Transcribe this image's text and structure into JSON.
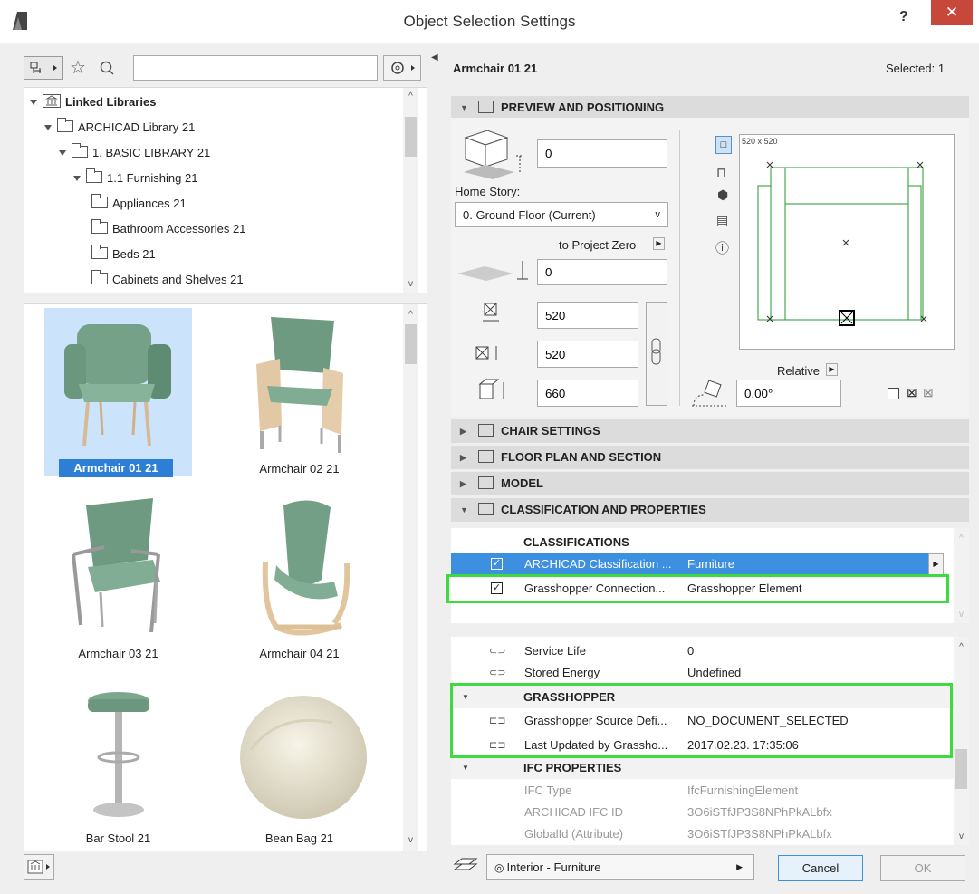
{
  "window": {
    "title": "Object Selection Settings",
    "help": "?",
    "close": "✕"
  },
  "left": {
    "search_placeholder": "",
    "tree": [
      {
        "label": "Linked Libraries",
        "level": 0,
        "bold": true
      },
      {
        "label": "ARCHICAD Library 21",
        "level": 1
      },
      {
        "label": "1. BASIC LIBRARY 21",
        "level": 2
      },
      {
        "label": "1.1 Furnishing 21",
        "level": 3
      },
      {
        "label": "Appliances 21",
        "level": 4
      },
      {
        "label": "Bathroom Accessories 21",
        "level": 4
      },
      {
        "label": "Beds 21",
        "level": 4
      },
      {
        "label": "Cabinets and Shelves 21",
        "level": 4
      }
    ],
    "objects": [
      {
        "name": "Armchair 01 21",
        "selected": true
      },
      {
        "name": "Armchair 02 21"
      },
      {
        "name": "Armchair 03 21"
      },
      {
        "name": "Armchair 04 21"
      },
      {
        "name": "Bar Stool 21"
      },
      {
        "name": "Bean Bag 21"
      }
    ]
  },
  "header": {
    "object_name": "Armchair 01 21",
    "selected": "Selected: 1"
  },
  "preview": {
    "section_title": "PREVIEW AND POSITIONING",
    "elevation": "0",
    "home_story_label": "Home Story:",
    "home_story_value": "0. Ground Floor (Current)",
    "to_project_zero": "to Project Zero",
    "project_zero_value": "0",
    "width": "520",
    "depth": "520",
    "height": "660",
    "angle": "0,00°",
    "preview_size": "520 x 520",
    "relative": "Relative"
  },
  "sections": {
    "chair": "CHAIR SETTINGS",
    "floor": "FLOOR PLAN AND SECTION",
    "model": "MODEL",
    "classification": "CLASSIFICATION AND PROPERTIES"
  },
  "classifications": {
    "header": "CLASSIFICATIONS",
    "rows": [
      {
        "name": "ARCHICAD Classification ...",
        "value": "Furniture",
        "selected": true
      },
      {
        "name": "Grasshopper Connection...",
        "value": "Grasshopper Element"
      }
    ]
  },
  "properties": {
    "rows": [
      {
        "name": "Service Life",
        "value": "0"
      },
      {
        "name": "Stored Energy",
        "value": "Undefined"
      }
    ],
    "grasshopper": {
      "header": "GRASSHOPPER",
      "rows": [
        {
          "name": "Grasshopper Source Defi...",
          "value": "NO_DOCUMENT_SELECTED"
        },
        {
          "name": "Last Updated by Grassho...",
          "value": "2017.02.23. 17:35:06"
        }
      ]
    },
    "ifc": {
      "header": "IFC PROPERTIES",
      "rows": [
        {
          "name": "IFC Type",
          "value": "IfcFurnishingElement"
        },
        {
          "name": "ARCHICAD IFC ID",
          "value": "3O6iSTfJP3S8NPhPkALbfx"
        },
        {
          "name": "GlobalId (Attribute)",
          "value": "3O6iSTfJP3S8NPhPkALbfx"
        }
      ]
    }
  },
  "footer": {
    "layer": "Interior - Furniture",
    "cancel": "Cancel",
    "ok": "OK"
  }
}
